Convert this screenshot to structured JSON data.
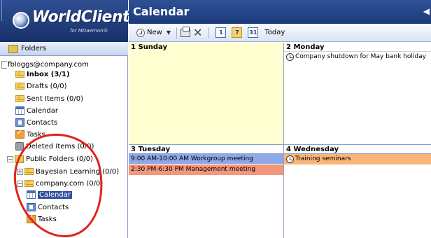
{
  "logo": {
    "brand": "WorldClient",
    "tagline": "for MDaemon®"
  },
  "folders": {
    "header": "Folders",
    "account": "fbloggs@company.com",
    "items": {
      "inbox": "Inbox (3/1)",
      "drafts": "Drafts (0/0)",
      "sent": "Sent Items (0/0)",
      "calendar": "Calendar",
      "contacts": "Contacts",
      "tasks": "Tasks",
      "deleted": "Deleted Items (0/0)",
      "public": "Public Folders (0/0)",
      "bayesian": "Bayesian Learning (0/0)",
      "company": "company.com (0/0)",
      "company_calendar": "Calendar",
      "company_contacts": "Contacts",
      "company_tasks": "Tasks"
    }
  },
  "calendar": {
    "title": "Calendar",
    "toolbar": {
      "new_label": "New",
      "day_view": "1",
      "week_view": "7",
      "month_view": "31",
      "today_label": "Today"
    },
    "days": [
      {
        "label": "1 Sunday",
        "events": []
      },
      {
        "label": "2 Monday",
        "events": [
          "Company shutdown for May bank holiday"
        ]
      },
      {
        "label": "3 Tuesday",
        "events": [
          "9:00 AM-10:00 AM Workgroup meeting",
          "2:30 PM-6:30 PM Management meeting"
        ]
      },
      {
        "label": "4 Wednesday",
        "events": [
          "Training seminars"
        ]
      }
    ]
  },
  "colors": {
    "header_blue": "#1c3a7a",
    "today_highlight": "#ffffd2",
    "event_blue": "#8ea8e8",
    "event_red": "#f2977c",
    "event_orange": "#fbb57a",
    "annotation_red": "#e0231c"
  }
}
